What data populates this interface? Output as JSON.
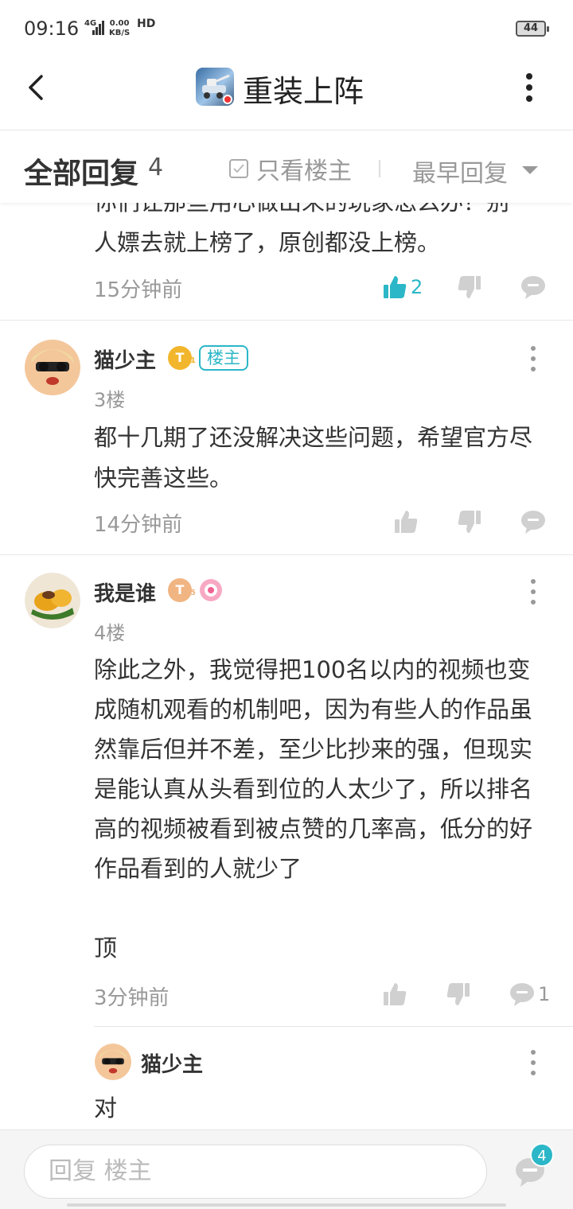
{
  "status_bar": {
    "time": "09:16",
    "network": "4G",
    "speed_value": "0.00",
    "speed_unit": "KB/S",
    "hd": "HD",
    "battery": "44"
  },
  "header": {
    "title": "重装上阵",
    "back_icon": "back-arrow-icon",
    "more_icon": "more-vertical-icon"
  },
  "filter_bar": {
    "title": "全部回复",
    "count": "4",
    "only_op_label": "只看楼主",
    "sort_label": "最早回复"
  },
  "comments": [
    {
      "text": "你们让那些用心做出来的玩家怎么办？别人嫖去就上榜了，原创都没上榜。",
      "visible_text": "人嫖去就上榜了，原创都没上榜。",
      "partial_top": "你们让那些用心做出来的玩家怎么办？别",
      "time": "15分钟前",
      "likes": "2",
      "liked": true
    },
    {
      "username": "猫少主",
      "level": "T",
      "level_sub": "1",
      "op_tag": "楼主",
      "floor": "3楼",
      "text": "都十几期了还没解决这些问题，希望官方尽快完善这些。",
      "time": "14分钟前"
    },
    {
      "username": "我是谁",
      "level": "T",
      "level_sub": "5",
      "floor": "4楼",
      "text": "除此之外，我觉得把100名以内的视频也变成随机观看的机制吧，因为有些人的作品虽然靠后但并不差，至少比抄来的强，但现实是能认真从头看到位的人太少了，所以排名高的视频被看到被点赞的几率高，低分的好作品看到的人就少了\n\n顶",
      "time": "3分钟前",
      "reply_count": "1"
    }
  ],
  "sub_reply": {
    "username": "猫少主",
    "text": "对"
  },
  "bottom_bar": {
    "placeholder": "回复  楼主",
    "reply_badge": "4"
  },
  "colors": {
    "accent": "#2bb7c7",
    "text_gray": "#999999",
    "icon_gray": "#d0d0d0"
  }
}
